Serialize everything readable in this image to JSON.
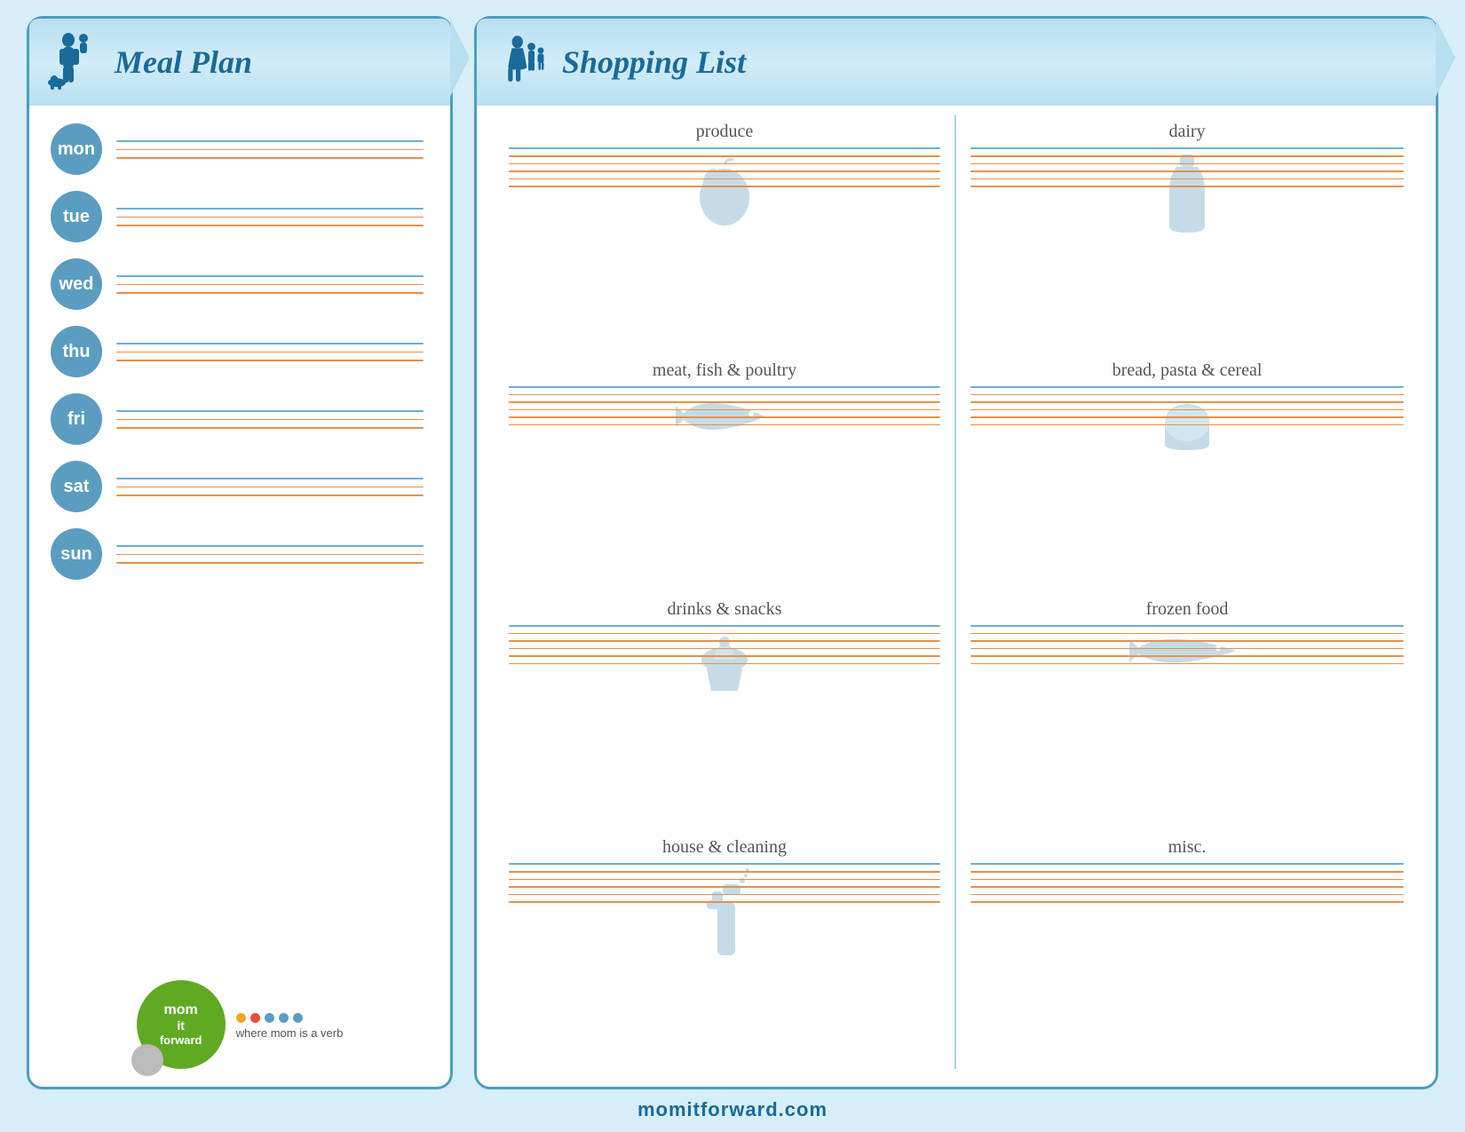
{
  "meal_plan": {
    "title": "Meal Plan",
    "days": [
      {
        "label": "mon"
      },
      {
        "label": "tue"
      },
      {
        "label": "wed"
      },
      {
        "label": "thu"
      },
      {
        "label": "fri"
      },
      {
        "label": "sat"
      },
      {
        "label": "sun"
      }
    ]
  },
  "shopping_list": {
    "title": "Shopping List",
    "sections": [
      {
        "id": "produce",
        "title": "produce",
        "icon": "apple"
      },
      {
        "id": "dairy",
        "title": "dairy",
        "icon": "bottle"
      },
      {
        "id": "meat",
        "title": "meat, fish & poultry",
        "icon": "fish"
      },
      {
        "id": "bread",
        "title": "bread, pasta & cereal",
        "icon": "bread"
      },
      {
        "id": "drinks",
        "title": "drinks & snacks",
        "icon": "cupcake"
      },
      {
        "id": "frozen",
        "title": "frozen food",
        "icon": "fish2"
      },
      {
        "id": "house",
        "title": "house & cleaning",
        "icon": "spray"
      },
      {
        "id": "misc",
        "title": "misc.",
        "icon": "none"
      }
    ]
  },
  "footer": {
    "website": "momitforward.com"
  },
  "logo": {
    "line1": "mom",
    "line2": "it",
    "line3": "forward",
    "tagline": "where mom is a verb",
    "dots": [
      "#f5a623",
      "#e84c3d",
      "#5b9dc0",
      "#5b9dc0",
      "#5b9dc0"
    ]
  }
}
